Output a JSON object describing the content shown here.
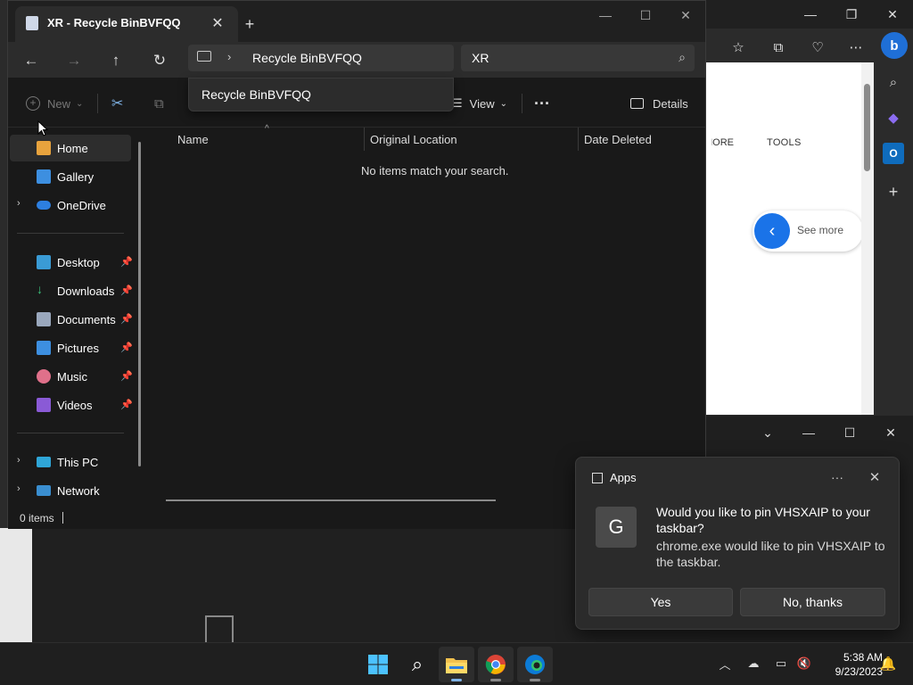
{
  "explorer": {
    "tab_title": "XR - Recycle BinBVFQQ",
    "address_path": "Recycle BinBVFQQ",
    "address_suggestion": "Recycle BinBVFQQ",
    "search_value": "XR",
    "toolbar": {
      "new_label": "New",
      "view_label": "View",
      "details_label": "Details"
    },
    "sidebar": {
      "home": "Home",
      "gallery": "Gallery",
      "onedrive": "OneDrive",
      "desktop": "Desktop",
      "downloads": "Downloads",
      "documents": "Documents",
      "pictures": "Pictures",
      "music": "Music",
      "videos": "Videos",
      "this_pc": "This PC",
      "network": "Network"
    },
    "columns": {
      "name": "Name",
      "original_location": "Original Location",
      "date_deleted": "Date Deleted"
    },
    "empty_message": "No items match your search.",
    "status_count": "0 items"
  },
  "edge": {
    "tools_label": "TOOLS",
    "more_label": "MORE",
    "see_more_label": "See more"
  },
  "toast": {
    "app_name": "Apps",
    "badge_letter": "G",
    "title": "Would you like to pin VHSXAIP to your taskbar?",
    "body": "chrome.exe would like to pin VHSXAIP to the taskbar.",
    "yes_label": "Yes",
    "no_label": "No, thanks"
  },
  "taskbar": {
    "time": "5:38 AM",
    "date": "9/23/2023"
  },
  "colors": {
    "accent": "#0078d4",
    "edge_blue": "#1a73e8"
  }
}
